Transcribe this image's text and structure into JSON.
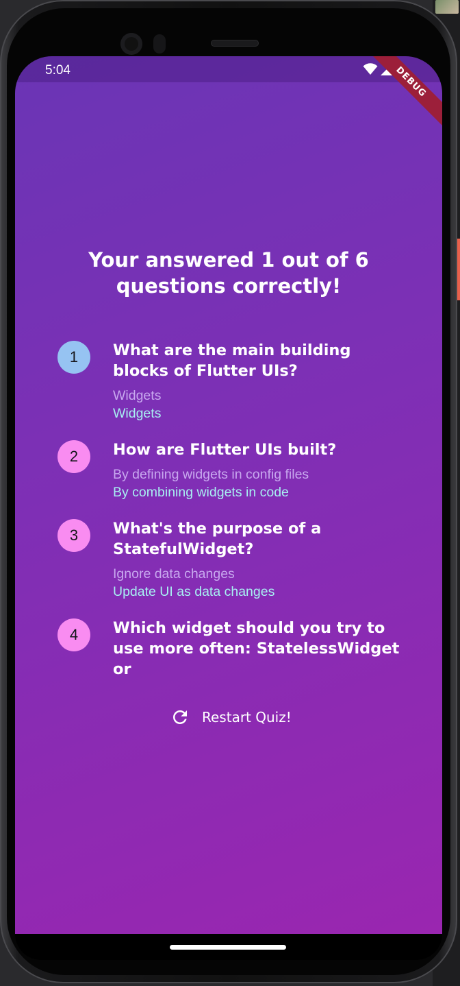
{
  "status_bar": {
    "time": "5:04",
    "icons": [
      "wifi-icon",
      "signal-icon"
    ]
  },
  "debug_banner": "DEBUG",
  "results": {
    "title": "Your answered 1 out of 6 questions correctly!",
    "summary": [
      {
        "index": "1",
        "question": "What are the main building blocks of Flutter UIs?",
        "user_answer": "Widgets",
        "correct_answer": "Widgets",
        "is_correct": true
      },
      {
        "index": "2",
        "question": "How are Flutter UIs built?",
        "user_answer": "By defining widgets in config files",
        "correct_answer": "By combining widgets in code",
        "is_correct": false
      },
      {
        "index": "3",
        "question": "What's the purpose of a StatefulWidget?",
        "user_answer": "Ignore data changes",
        "correct_answer": "Update UI as data changes",
        "is_correct": false
      },
      {
        "index": "4",
        "question": "Which widget should you try to use more often: StatelessWidget or",
        "is_correct": false
      }
    ]
  },
  "restart_button": {
    "label": "Restart Quiz!",
    "icon": "refresh-icon"
  },
  "colors": {
    "background_top": "#6a35b5",
    "background_bottom": "#9a26b0",
    "correct_circle": "#96c3f2",
    "wrong_circle": "#f98cf1",
    "user_answer": "#c8a8ef",
    "correct_answer": "#a8f0f2",
    "debug_banner": "#9c1f3a"
  }
}
